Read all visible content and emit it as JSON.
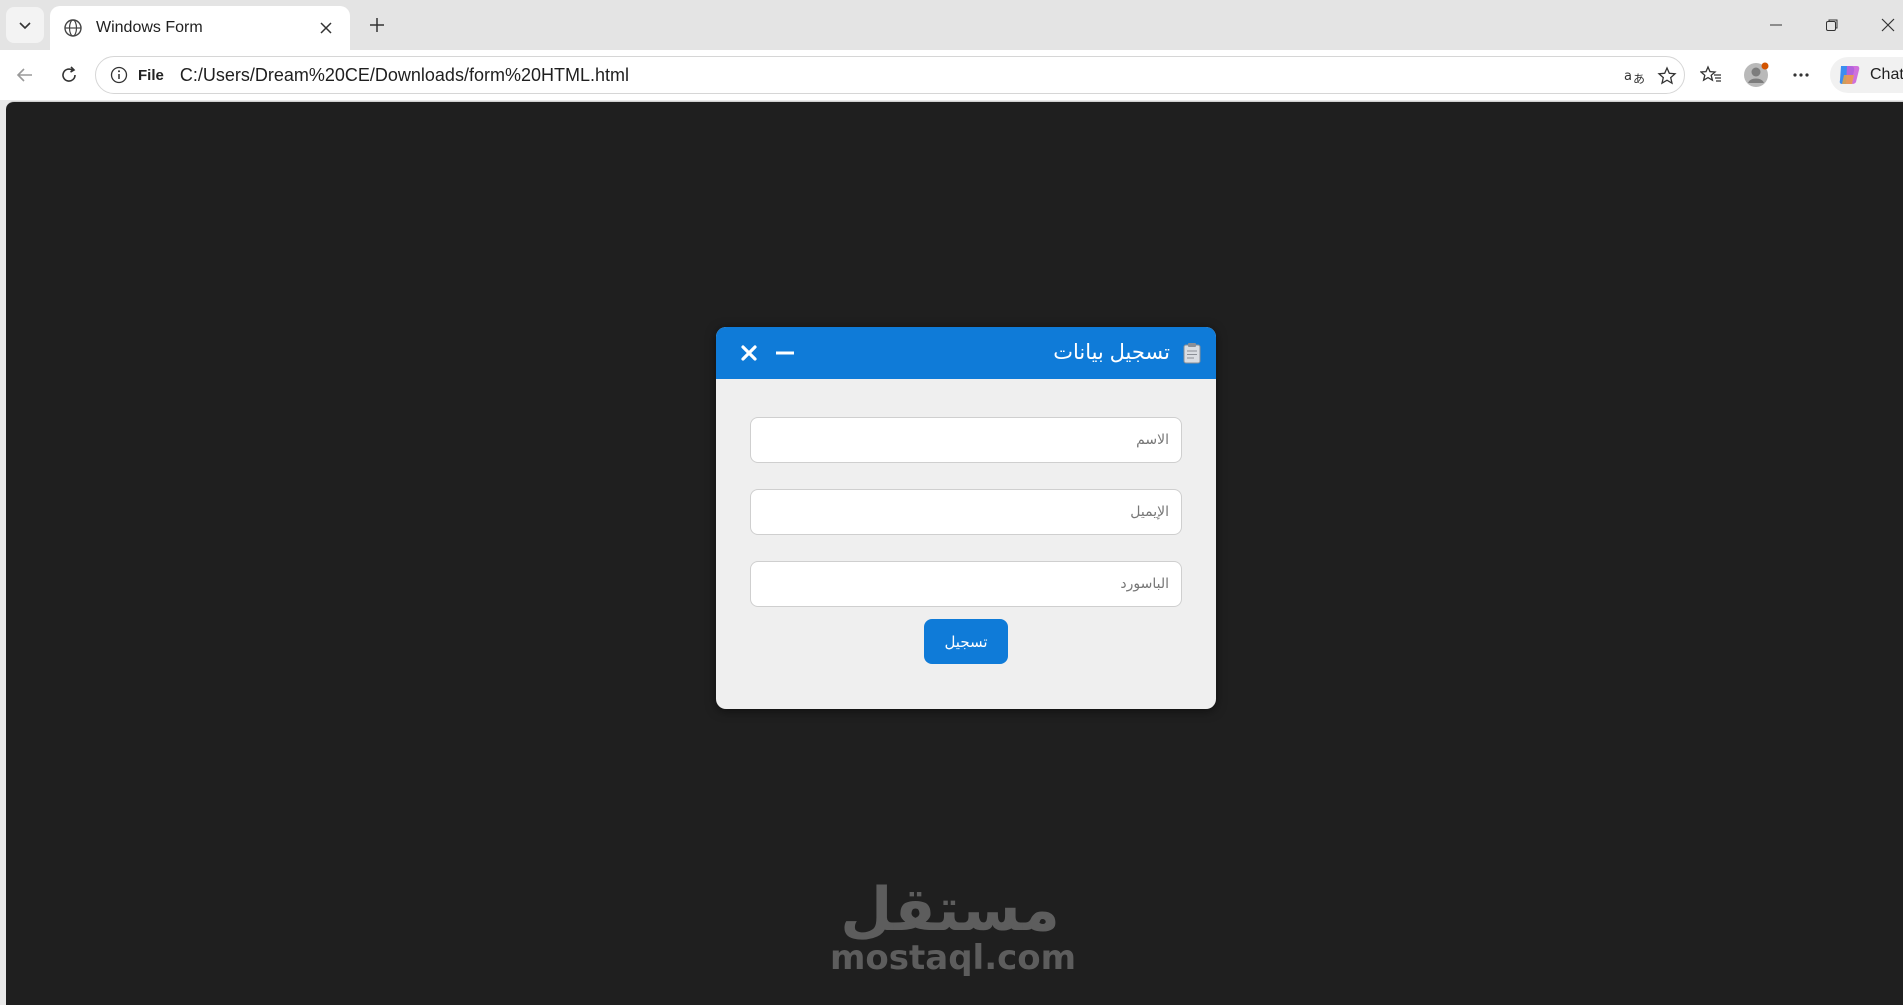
{
  "browser": {
    "tab": {
      "title": "Windows Form"
    },
    "address": {
      "scheme_label": "File",
      "url": "C:/Users/Dream%20CE/Downloads/form%20HTML.html"
    },
    "copilot_label": "Chat"
  },
  "form": {
    "title": "تسجيل بيانات",
    "fields": {
      "name_placeholder": "الاسم",
      "email_placeholder": "الإيميل",
      "password_placeholder": "الباسورد"
    },
    "submit_label": "تسجيل"
  },
  "watermark": {
    "arabic": "مستقل",
    "latin": "mostaql.com"
  },
  "colors": {
    "accent": "#0f7bd8",
    "page_background": "#1f1f1f",
    "form_background": "#efefef"
  }
}
